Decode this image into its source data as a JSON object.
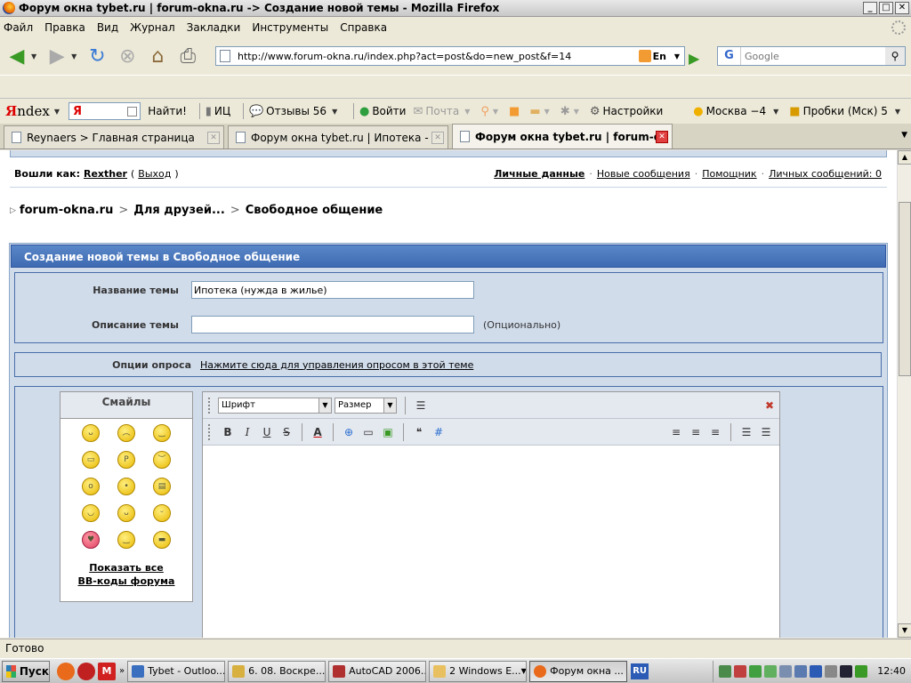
{
  "window": {
    "title": "Форум окна tybet.ru | forum-okna.ru -> Создание новой темы - Mozilla Firefox",
    "minimize": "_",
    "maximize": "□",
    "close": "✕"
  },
  "menu": [
    "Файл",
    "Правка",
    "Вид",
    "Журнал",
    "Закладки",
    "Инструменты",
    "Справка"
  ],
  "navbar": {
    "url": "http://www.forum-okna.ru/index.php?act=post&do=new_post&f=14",
    "lang_badge": "En",
    "search_engine": "G",
    "search_placeholder": "Google"
  },
  "yandex": {
    "logo_red": "Я",
    "logo_rest": "ndex",
    "input_prefix": "Я",
    "find_button": "Найти!",
    "ic_label": "ИЦ",
    "reviews": "Отзывы 56",
    "login": "Войти",
    "mail": "Почта",
    "settings": "Настройки",
    "weather": "Москва −4",
    "traffic": "Пробки (Мск) 5"
  },
  "tabs": [
    {
      "label": "Reynaers > Главная страница",
      "active": false
    },
    {
      "label": "Форум окна tybet.ru | Ипотека - for...",
      "active": false
    },
    {
      "label": "Форум окна tybet.ru | forum-ok...",
      "active": true
    }
  ],
  "userbar": {
    "logged_as": "Вошли как:",
    "username": "Rexther",
    "logout": "Выход",
    "links": [
      "Личные данные",
      "Новые сообщения",
      "Помощник",
      "Личных сообщений: 0"
    ]
  },
  "breadcrumb": [
    "forum-okna.ru",
    "Для друзей...",
    "Свободное общение"
  ],
  "form": {
    "header": "Создание новой темы в Свободное общение",
    "title_label": "Название темы",
    "title_value": "Ипотека (нужда в жилье)",
    "desc_label": "Описание темы",
    "desc_value": "",
    "desc_hint": "(Опционально)",
    "poll_label": "Опции опроса",
    "poll_link": "Нажмите сюда для управления опросом в этой теме"
  },
  "smilies": {
    "title": "Смайлы",
    "show_all_line1": "Показать все",
    "show_all_line2": "BB-коды форума"
  },
  "editor": {
    "font_select": "Шрифт",
    "size_select": "Размер",
    "bold": "B",
    "italic": "I",
    "underline": "U",
    "strike": "S",
    "color": "A",
    "close": "✖"
  },
  "statusbar": {
    "text": "Готово"
  },
  "taskbar": {
    "start": "Пуск",
    "buttons": [
      "Tybet - Outloo...",
      "6. 08. Воскре...",
      "AutoCAD 2006...",
      "2 Windows E...",
      "Форум окна ..."
    ],
    "lang": "RU",
    "clock": "12:40"
  }
}
